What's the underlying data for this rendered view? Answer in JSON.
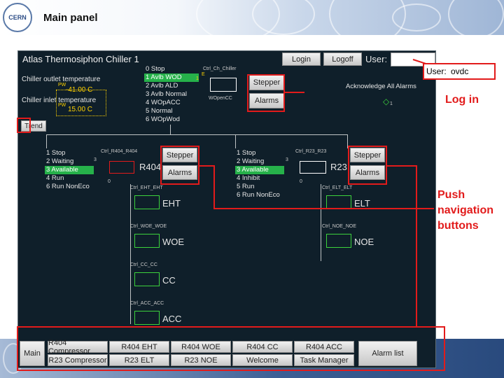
{
  "header": {
    "title": "Main panel",
    "logo": "CERN"
  },
  "window": {
    "title": "Atlas Thermosiphon Chiller 1",
    "login_label": "Login",
    "logoff_label": "Logoff",
    "user_label": "User:",
    "user_value": ""
  },
  "chiller": {
    "out_label": "Chiller outlet temperature",
    "out_value": "-41.00 C",
    "in_label": "Chiller inlet temperature",
    "in_value": "15.00 C",
    "trend_label": "Trend",
    "pw": "PW",
    "states": [
      "0 Stop",
      "1 Avlb WOD",
      "2 Avlb ALD",
      "3 Avlb Normal",
      "4 WOpACC",
      "5 Normal",
      "6 WOpWod"
    ],
    "selected": 1,
    "ctrl_label": "Ctrl_Ch_Chiller",
    "e_label": "E",
    "one_label": "1",
    "wopen_label": "WOpenCC",
    "stepper_label": "Stepper",
    "alarms_label": "Alarms",
    "ack_label": "Acknowledge All Alarms",
    "ack_num": "1"
  },
  "r404": {
    "name": "R404",
    "ctrl": "Ctrl_R404_R404",
    "states": [
      "1 Stop",
      "2 Waiting",
      "3 Available",
      "4 Run",
      "6 Run NonEco"
    ],
    "selected": 2,
    "stepper_label": "Stepper",
    "alarms_label": "Alarms",
    "num": "3",
    "zero": "0",
    "children": [
      {
        "ctrl": "Ctrl_EHT_EHT",
        "name": "EHT"
      },
      {
        "ctrl": "Ctrl_WOE_WOE",
        "name": "WOE"
      },
      {
        "ctrl": "Ctrl_CC_CC",
        "name": "CC"
      },
      {
        "ctrl": "Ctrl_ACC_ACC",
        "name": "ACC"
      }
    ]
  },
  "r23": {
    "name": "R23",
    "ctrl": "Ctrl_R23_R23",
    "states": [
      "1 Stop",
      "2 Waiting",
      "3 Available",
      "4 Inhibit",
      "5 Run",
      "6 Run NonEco"
    ],
    "selected": 2,
    "stepper_label": "Stepper",
    "alarms_label": "Alarms",
    "num": "3",
    "zero": "0",
    "children": [
      {
        "ctrl": "Ctrl_ELT_ELT",
        "name": "ELT"
      },
      {
        "ctrl": "Ctrl_NOE_NOE",
        "name": "NOE"
      }
    ]
  },
  "nav": {
    "main": "Main",
    "alarm_list": "Alarm list",
    "row1": [
      "R404 Compressor",
      "R404 EHT",
      "R404 WOE",
      "R404 CC",
      "R404 ACC"
    ],
    "row2": [
      "R23 Compressor",
      "R23 ELT",
      "R23 NOE",
      "Welcome",
      "Task Manager"
    ]
  },
  "annotations": {
    "login": "Log in",
    "push": "Push navigation buttons",
    "user_popup_label": "User:",
    "user_popup_value": "ovdc"
  }
}
